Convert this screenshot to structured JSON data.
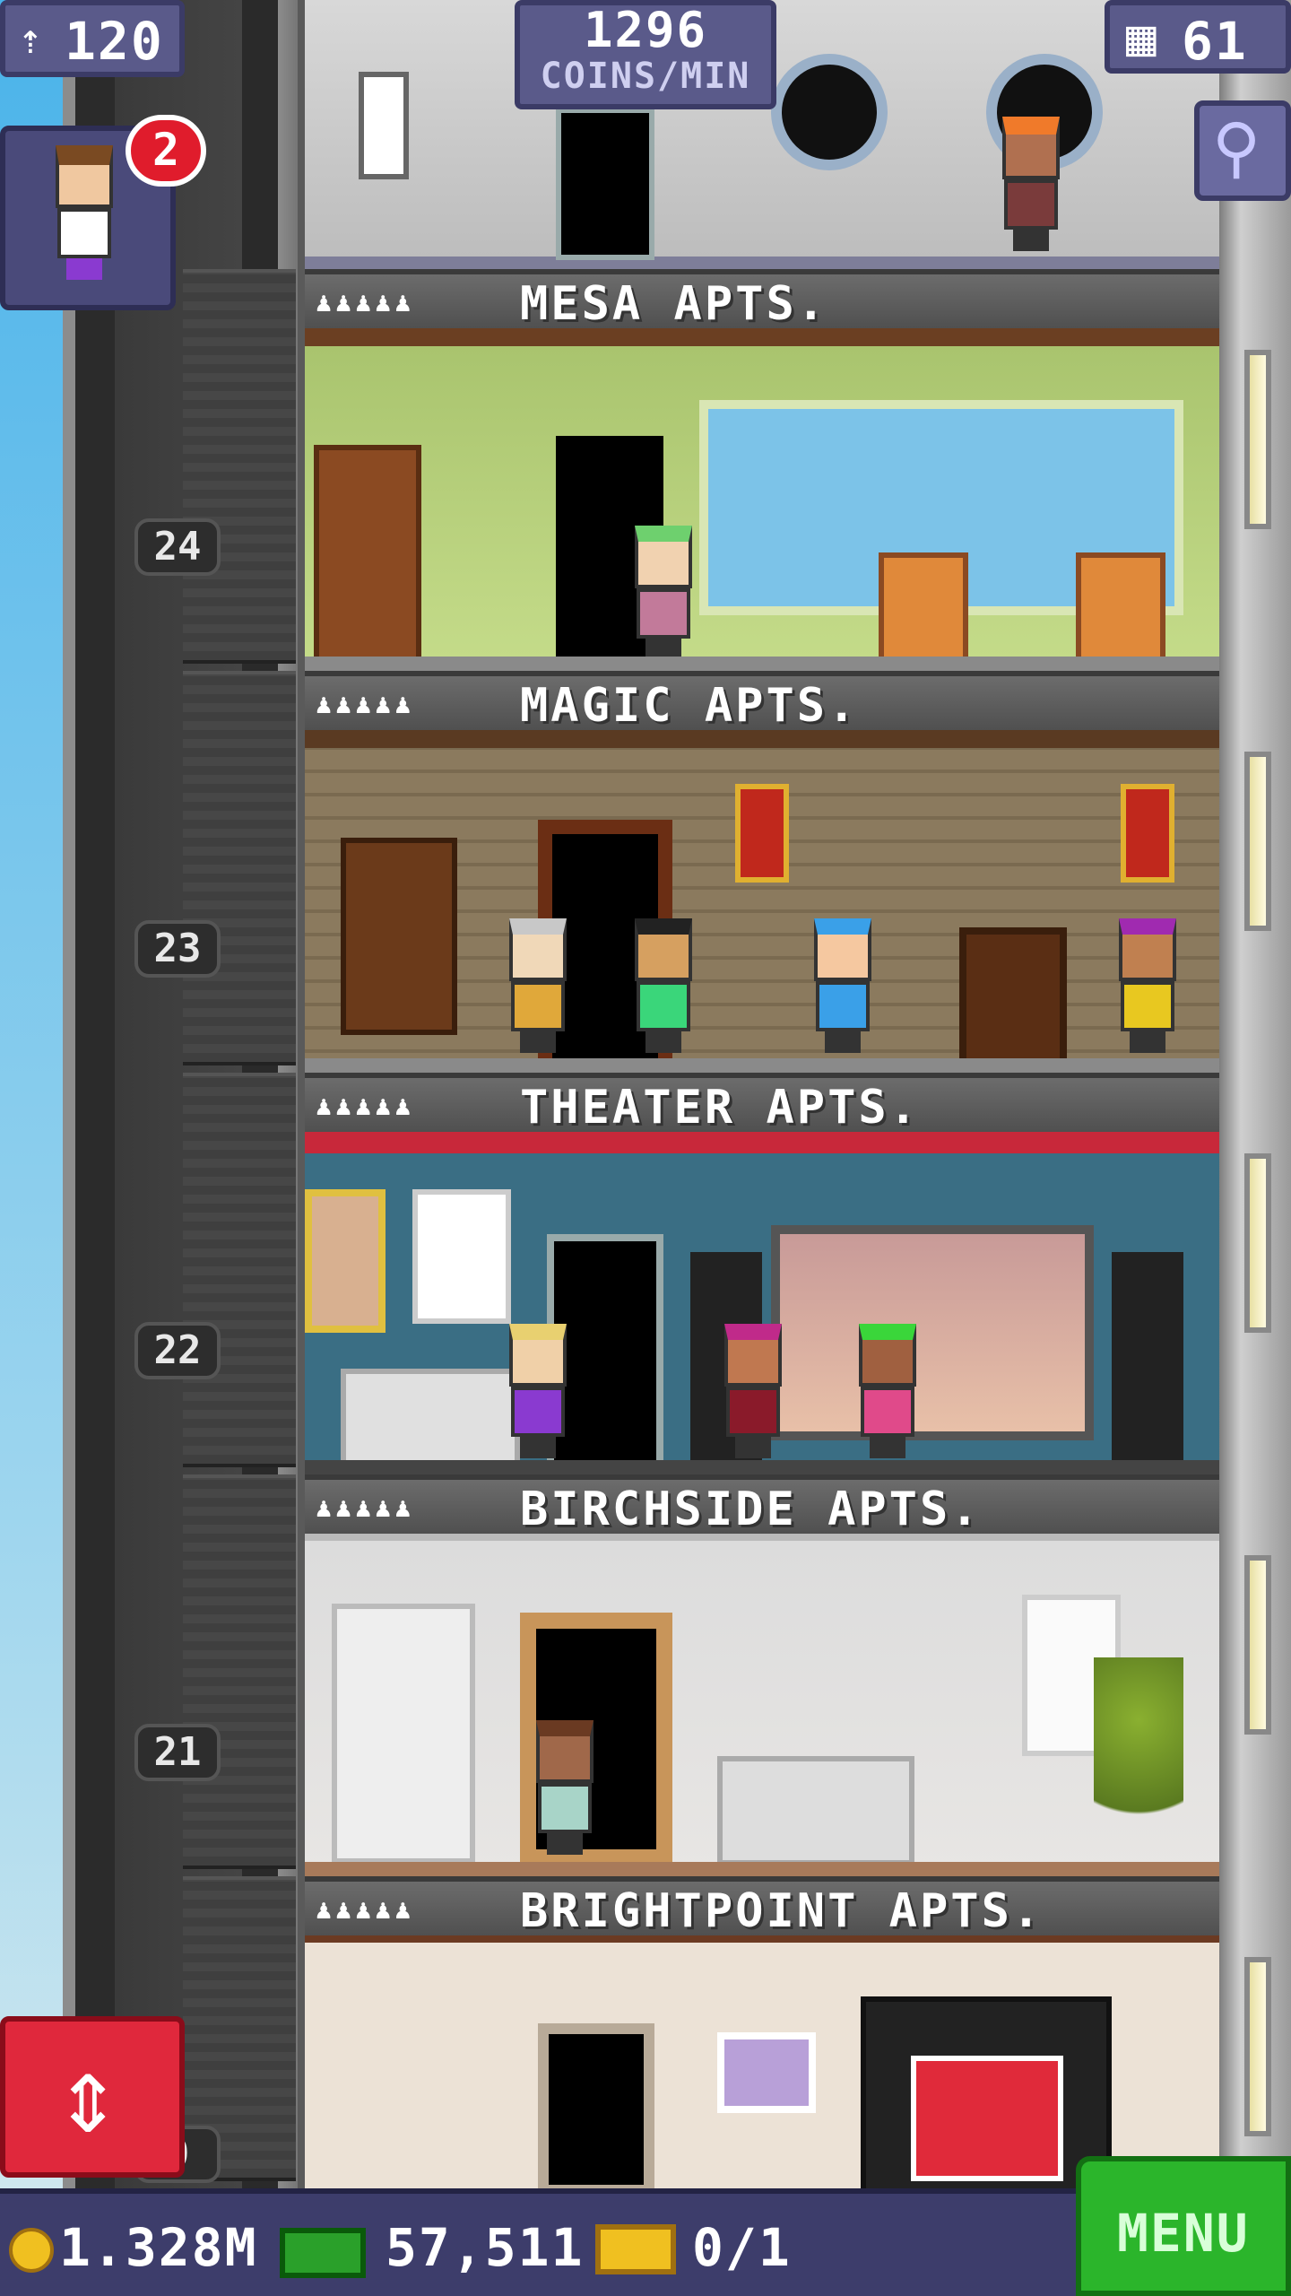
{
  "hud": {
    "population": "120",
    "coins_per_min_value": "1296",
    "coins_per_min_label": "COINS/MIN",
    "floor_count": "61",
    "notification_count": "2"
  },
  "bottom_bar": {
    "coins": "1.328M",
    "tower_bux": "57,511",
    "tickets": "0/1",
    "menu_label": "MENU"
  },
  "floor_numbers": [
    "24",
    "23",
    "22",
    "21",
    "0"
  ],
  "apartments": [
    {
      "name": "MESA APTS.",
      "stars": "♟♟♟♟♟"
    },
    {
      "name": "MAGIC APTS.",
      "stars": "♟♟♟♟♟"
    },
    {
      "name": "THEATER APTS.",
      "stars": "♟♟♟♟♟"
    },
    {
      "name": "BIRCHSIDE APTS.",
      "stars": "♟♟♟♟♟"
    },
    {
      "name": "BRIGHTPOINT APTS.",
      "stars": "♟♟♟♟♟"
    }
  ],
  "colors": {
    "hud_panel": "#5a5a8a",
    "menu_button": "#2bb52b",
    "elevator_button": "#e0283c",
    "badge": "#e01c2c"
  },
  "icons": {
    "population": "person-icon",
    "floors": "building-icon",
    "search": "magnifier-icon",
    "coins": "coin-icon",
    "bux": "cash-icon",
    "tickets": "ticket-icon",
    "elevator": "up-down-arrows-icon"
  }
}
